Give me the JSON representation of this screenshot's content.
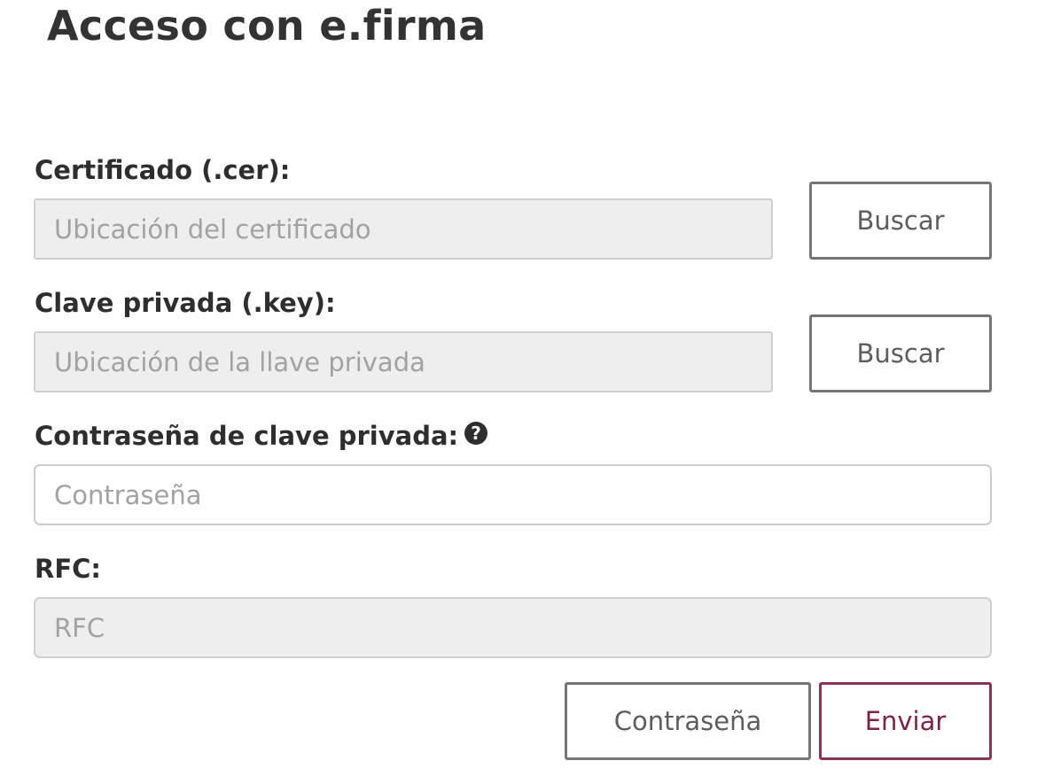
{
  "page": {
    "title": "Acceso con e.firma"
  },
  "form": {
    "cer": {
      "label": "Certificado (.cer):",
      "placeholder": "Ubicación del certificado",
      "button_label": "Buscar"
    },
    "key": {
      "label": "Clave privada (.key):",
      "placeholder": "Ubicación de la llave privada",
      "button_label": "Buscar"
    },
    "password": {
      "label": "Contraseña de clave privada:",
      "placeholder": "Contraseña",
      "help_icon": "question-circle-icon"
    },
    "rfc": {
      "label": "RFC:",
      "placeholder": "RFC"
    }
  },
  "actions": {
    "password_login_label": "Contraseña",
    "submit_label": "Enviar"
  },
  "colors": {
    "primary_accent": "#7b2547",
    "disabled_field": "#eeeeee",
    "button_border": "#767676"
  }
}
